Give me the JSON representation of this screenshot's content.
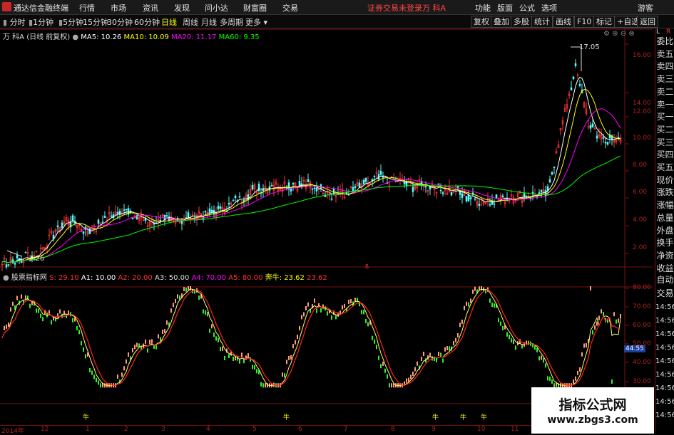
{
  "titlebar": {
    "app_name": "通达信金融终端",
    "menus": [
      "行情",
      "市场",
      "资讯",
      "发现",
      "问小达",
      "财富圈",
      "交易"
    ],
    "status": "证券交易未登录",
    "stock": "万 科A",
    "right_menus": [
      "功能",
      "版面",
      "公式",
      "选项"
    ],
    "user": "游客"
  },
  "toolbar": {
    "periods": [
      "分时",
      "1分钟",
      "5分钟",
      "15分钟",
      "30分钟",
      "60分钟",
      "日线",
      "周线",
      "月线",
      "多周期",
      "更多"
    ],
    "active_period": "日线",
    "right_buttons": [
      "复权",
      "叠加",
      "多股",
      "统计",
      "画线",
      "F10",
      "标记",
      "+自选",
      "返回"
    ]
  },
  "main_chart": {
    "stock_label": "万 科A (日线 前复权)",
    "ma5": "MA5: 10.26",
    "ma10": "MA10: 10.09",
    "ma20": "MA20: 11.17",
    "ma60": "MA60: 9.35",
    "high_label": "17.05",
    "low_label": "1.26",
    "y_ticks": [
      "16.00",
      "14.00",
      "12.00",
      "10.00",
      "8.00",
      "6.00",
      "4.00",
      "2.00"
    ],
    "colors": {
      "ma5": "#ffffff",
      "ma10": "#ffff00",
      "ma20": "#ff00ff",
      "ma60": "#00ff00",
      "up": "#ff3333",
      "down": "#54fcfc",
      "grid": "#7a1010"
    }
  },
  "indicator": {
    "name": "股票指标网",
    "s": "S: 29.10",
    "a1": "A1: 10.00",
    "a2": "A2: 20.00",
    "a3": "A3: 50.00",
    "a4": "A4: 70.00",
    "a5": "A5: 80.00",
    "bull_label": "奔牛: 23.62",
    "bull_value2": "23.62",
    "y_ticks": [
      "80.00",
      "70.00",
      "60.00",
      "50.00",
      "40.00",
      "30.00"
    ],
    "current_value": "44.55",
    "markers": [
      "牛",
      "牛",
      "牛",
      "牛",
      "牛"
    ]
  },
  "x_axis": {
    "labels": [
      "2014年",
      "12",
      "1",
      "2",
      "3",
      "4",
      "5",
      "6",
      "7",
      "8",
      "9",
      "10",
      "11"
    ]
  },
  "right_panel": {
    "top_letters": [
      "L",
      "R"
    ],
    "items": [
      "委比",
      "卖五",
      "卖四",
      "卖三",
      "卖二",
      "卖一",
      "买一",
      "买二",
      "买三",
      "买四",
      "买五",
      "现价",
      "涨跌",
      "涨幅",
      "总量",
      "外盘",
      "换手",
      "净资",
      "收益"
    ],
    "bottom_items": [
      "自动",
      "交易",
      "14:56",
      "14:56",
      "14:56",
      "14:56",
      "14:56",
      "14:56",
      "14:56",
      "14:56",
      "14:56"
    ]
  },
  "watermark": {
    "title": "指标公式网",
    "url": "www.zbgs3.com"
  }
}
